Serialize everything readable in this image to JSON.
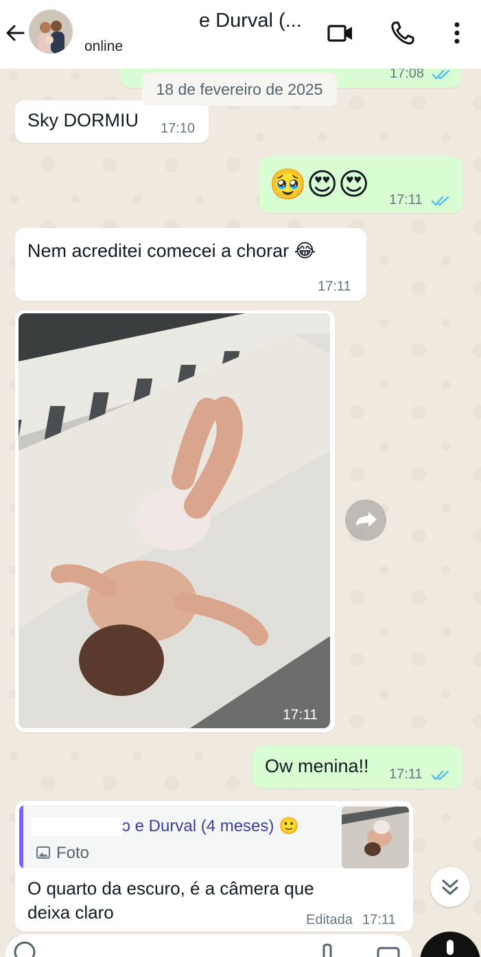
{
  "header": {
    "contact_name": "e Durval (...",
    "status": "online"
  },
  "date_separator": "18 de fevereiro de 2025",
  "messages": [
    {
      "type": "out",
      "time": "17:08"
    },
    {
      "type": "in",
      "text": "Sky DORMIU",
      "time": "17:10"
    },
    {
      "type": "out",
      "text": "🥹😍😍",
      "time": "17:11"
    },
    {
      "type": "in",
      "text": "Nem acreditei comecei a chorar 😂",
      "time": "17:11"
    },
    {
      "type": "in-photo",
      "time": "17:11"
    },
    {
      "type": "out",
      "text": "Ow menina!!",
      "time": "17:11"
    },
    {
      "type": "in-reply",
      "quote_author": "ɔ e Durval (4 meses) 🙂",
      "quote_media": "Foto",
      "text_line1": "O quarto da escuro, é a câmera que",
      "text_line2": "deixa claro",
      "edited_label": "Editada",
      "time": "17:11"
    }
  ],
  "colors": {
    "outgoing_bubble": "#d9fdd3",
    "incoming_bubble": "#ffffff",
    "read_ticks": "#53bdeb",
    "quote_bar": "#7b61ff"
  }
}
